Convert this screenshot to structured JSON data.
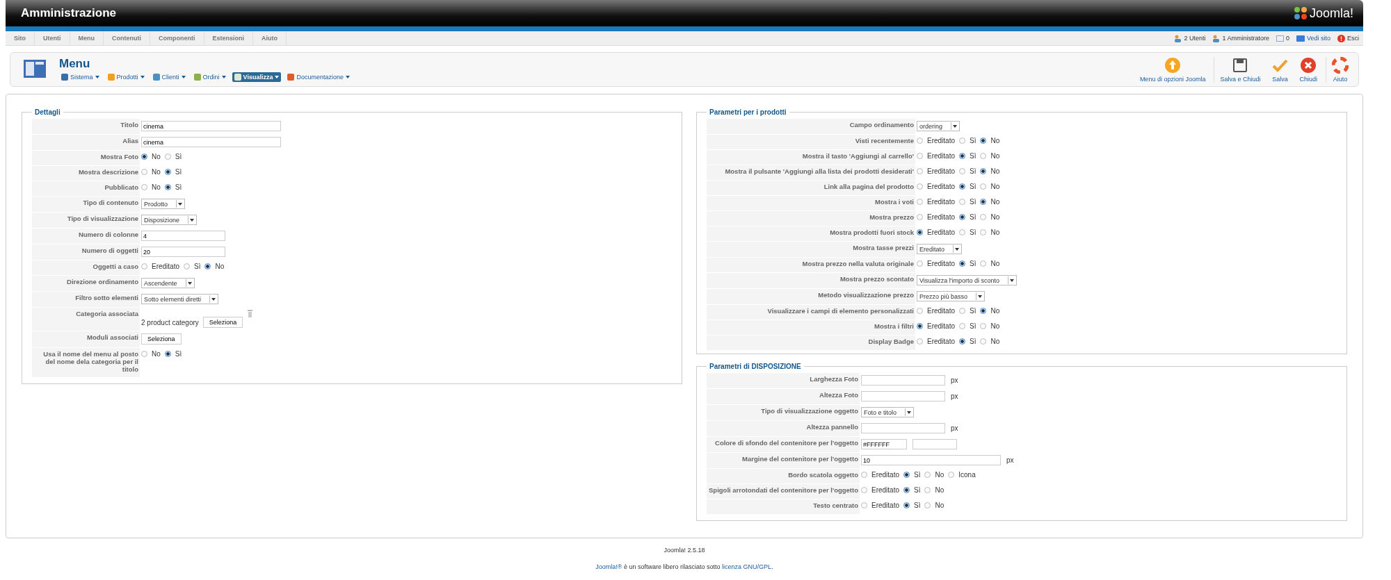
{
  "header": {
    "title": "Amministrazione",
    "logo": "Joomla!"
  },
  "menubar": {
    "items": [
      "Sito",
      "Utenti",
      "Menu",
      "Contenuti",
      "Componenti",
      "Estensioni",
      "Aiuto"
    ],
    "status": [
      {
        "kind": "users",
        "label": "2 Utenti"
      },
      {
        "kind": "users",
        "label": "1 Amministratore"
      },
      {
        "kind": "messages",
        "label": "0"
      },
      {
        "kind": "site",
        "label": "Vedi sito"
      },
      {
        "kind": "logout",
        "label": "Esci"
      }
    ]
  },
  "toolbar": {
    "title": "Menu",
    "submenu": [
      {
        "kind": "tools",
        "label": "Sistema",
        "selected": false
      },
      {
        "kind": "box",
        "label": "Prodotti",
        "selected": false
      },
      {
        "kind": "users",
        "label": "Clienti",
        "selected": false
      },
      {
        "kind": "orders",
        "label": "Ordini",
        "selected": false
      },
      {
        "kind": "view",
        "label": "Visualizza",
        "selected": true
      },
      {
        "kind": "help",
        "label": "Documentazione",
        "selected": false
      }
    ],
    "actions": [
      {
        "kind": "options",
        "label": "Menu di opzioni Joomla"
      },
      {
        "kind": "save",
        "label": "Salva e Chiudi"
      },
      {
        "kind": "apply",
        "label": "Salva"
      },
      {
        "kind": "cancel",
        "label": "Chiudi"
      },
      {
        "kind": "help",
        "label": "Aiuto"
      }
    ]
  },
  "dettagli": {
    "legend": "Dettagli",
    "fields": [
      {
        "label": "Titolo",
        "kind": "text",
        "value": "cinema"
      },
      {
        "label": "Alias",
        "kind": "text",
        "value": "cinema"
      },
      {
        "label": "Mostra Foto",
        "kind": "radio",
        "options": [
          {
            "label": "No",
            "selected": true
          },
          {
            "label": "Sì",
            "selected": false
          }
        ]
      },
      {
        "label": "Mostra descrizione",
        "kind": "radio",
        "options": [
          {
            "label": "No",
            "selected": false
          },
          {
            "label": "Sì",
            "selected": true
          }
        ]
      },
      {
        "label": "Pubblicato",
        "kind": "radio",
        "options": [
          {
            "label": "No",
            "selected": false
          },
          {
            "label": "Sì",
            "selected": true
          }
        ]
      },
      {
        "label": "Tipo di contenuto",
        "kind": "select",
        "value": "Prodotto"
      },
      {
        "label": "Tipo di visualizzazione",
        "kind": "select",
        "value": "Disposizione"
      },
      {
        "label": "Numero di colonne",
        "kind": "text",
        "value": "4"
      },
      {
        "label": "Numero di oggetti",
        "kind": "text",
        "value": "20"
      },
      {
        "label": "Oggetti a caso",
        "kind": "radio",
        "options": [
          {
            "label": "Ereditato",
            "selected": false
          },
          {
            "label": "Sì",
            "selected": false
          },
          {
            "label": "No",
            "selected": true
          }
        ]
      },
      {
        "label": "Direzione ordinamento",
        "kind": "select",
        "value": "Ascendente"
      },
      {
        "label": "Filtro sotto elementi",
        "kind": "select",
        "value": "Sotto elementi diretti"
      },
      {
        "label": "Categoria associata",
        "kind": "picker",
        "value": "2 product category",
        "button": "Seleziona"
      },
      {
        "label": "Moduli associati",
        "kind": "button",
        "button": "Seleziona"
      },
      {
        "label": "Usa il nome del menu al posto del nome dela categoria per il titolo",
        "kind": "radio",
        "options": [
          {
            "label": "No",
            "selected": false
          },
          {
            "label": "Sì",
            "selected": true
          }
        ]
      }
    ]
  },
  "prodotti": {
    "legend": "Parametri per i prodotti",
    "fields": [
      {
        "label": "Campo ordinamento",
        "kind": "select",
        "value": "ordering"
      },
      {
        "label": "Visti recentemente",
        "kind": "radio",
        "options": [
          {
            "label": "Ereditato",
            "selected": false
          },
          {
            "label": "Sì",
            "selected": false
          },
          {
            "label": "No",
            "selected": true
          }
        ]
      },
      {
        "label": "Mostra il tasto 'Aggiungi al carrello'",
        "kind": "radio",
        "options": [
          {
            "label": "Ereditato",
            "selected": false
          },
          {
            "label": "Sì",
            "selected": true
          },
          {
            "label": "No",
            "selected": false
          }
        ]
      },
      {
        "label": "Mostra il pulsante 'Aggiungi alla lista dei prodotti desiderati'",
        "kind": "radio",
        "options": [
          {
            "label": "Ereditato",
            "selected": false
          },
          {
            "label": "Sì",
            "selected": false
          },
          {
            "label": "No",
            "selected": true
          }
        ]
      },
      {
        "label": "Link alla pagina del prodotto",
        "kind": "radio",
        "options": [
          {
            "label": "Ereditato",
            "selected": false
          },
          {
            "label": "Sì",
            "selected": true
          },
          {
            "label": "No",
            "selected": false
          }
        ]
      },
      {
        "label": "Mostra i voti",
        "kind": "radio",
        "options": [
          {
            "label": "Ereditato",
            "selected": false
          },
          {
            "label": "Sì",
            "selected": false
          },
          {
            "label": "No",
            "selected": true
          }
        ]
      },
      {
        "label": "Mostra prezzo",
        "kind": "radio",
        "options": [
          {
            "label": "Ereditato",
            "selected": false
          },
          {
            "label": "Sì",
            "selected": true
          },
          {
            "label": "No",
            "selected": false
          }
        ]
      },
      {
        "label": "Mostra prodotti fuori stock",
        "kind": "radio",
        "options": [
          {
            "label": "Ereditato",
            "selected": true
          },
          {
            "label": "Sì",
            "selected": false
          },
          {
            "label": "No",
            "selected": false
          }
        ]
      },
      {
        "label": "Mostra tasse prezzi",
        "kind": "select",
        "value": "Ereditato"
      },
      {
        "label": "Mostra prezzo nella valuta originale",
        "kind": "radio",
        "options": [
          {
            "label": "Ereditato",
            "selected": false
          },
          {
            "label": "Sì",
            "selected": true
          },
          {
            "label": "No",
            "selected": false
          }
        ]
      },
      {
        "label": "Mostra prezzo scontato",
        "kind": "select",
        "value": "Visualizza l'importo di sconto"
      },
      {
        "label": "Metodo visualizzazione prezzo",
        "kind": "select",
        "value": "Prezzo più basso"
      },
      {
        "label": "Visualizzare i campi di elemento personalizzati",
        "kind": "radio",
        "options": [
          {
            "label": "Ereditato",
            "selected": false
          },
          {
            "label": "Sì",
            "selected": false
          },
          {
            "label": "No",
            "selected": true
          }
        ]
      },
      {
        "label": "Mostra i filtri",
        "kind": "radio",
        "options": [
          {
            "label": "Ereditato",
            "selected": true
          },
          {
            "label": "Sì",
            "selected": false
          },
          {
            "label": "No",
            "selected": false
          }
        ]
      },
      {
        "label": "Display Badge",
        "kind": "radio",
        "options": [
          {
            "label": "Ereditato",
            "selected": false
          },
          {
            "label": "Sì",
            "selected": true
          },
          {
            "label": "No",
            "selected": false
          }
        ]
      }
    ]
  },
  "disposizione": {
    "legend": "Parametri di DISPOSIZIONE",
    "fields": [
      {
        "label": "Larghezza Foto",
        "kind": "text",
        "unit": "px"
      },
      {
        "label": "Altezza Foto",
        "kind": "text",
        "unit": "px"
      },
      {
        "label": "Tipo di visualizzazione oggetto",
        "kind": "select",
        "value": "Foto e titolo"
      },
      {
        "label": "Altezza pannello",
        "kind": "text",
        "unit": "px"
      },
      {
        "label": "Colore di sfondo del contenitore per l'oggetto",
        "kind": "color",
        "value": "#FFFFFF"
      },
      {
        "label": "Margine del contenitore per l'oggetto",
        "kind": "text",
        "value": "10",
        "unit": "px"
      },
      {
        "label": "Bordo scatola oggetto",
        "kind": "radio",
        "options": [
          {
            "label": "Ereditato",
            "selected": false
          },
          {
            "label": "Sì",
            "selected": true
          },
          {
            "label": "No",
            "selected": false
          },
          {
            "label": "Icona",
            "selected": false
          }
        ]
      },
      {
        "label": "Spigoli arrotondati del contenitore per l'oggetto",
        "kind": "radio",
        "options": [
          {
            "label": "Ereditato",
            "selected": false
          },
          {
            "label": "Sì",
            "selected": true
          },
          {
            "label": "No",
            "selected": false
          }
        ]
      },
      {
        "label": "Testo centrato",
        "kind": "radio",
        "options": [
          {
            "label": "Ereditato",
            "selected": false
          },
          {
            "label": "Sì",
            "selected": true
          },
          {
            "label": "No",
            "selected": false
          }
        ]
      }
    ]
  },
  "footer": {
    "version": "Joomla! 2.5.18",
    "license": {
      "link": "Joomla!®",
      "text": " è un software libero rilasciato sotto ",
      "license_link": "licenza GNU/GPL",
      "end": "."
    }
  }
}
